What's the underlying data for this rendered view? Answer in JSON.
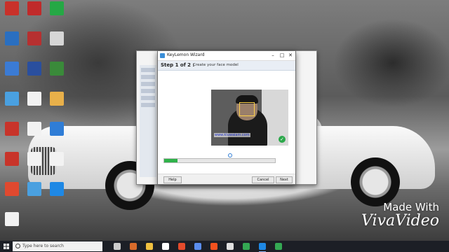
{
  "desktop_icons": [
    {
      "label": "",
      "color": "#c9312a"
    },
    {
      "label": "",
      "color": "#c02a2a"
    },
    {
      "label": "",
      "color": "#25a845"
    },
    {
      "label": "",
      "color": "#2a6fc0"
    },
    {
      "label": "",
      "color": "#b63030"
    },
    {
      "label": "",
      "color": "#d6d6d6"
    },
    {
      "label": "",
      "color": "#3b7bd4"
    },
    {
      "label": "",
      "color": "#2a4f9e"
    },
    {
      "label": "",
      "color": "#3a8a3a"
    },
    {
      "label": "",
      "color": "#4aa0e0"
    },
    {
      "label": "",
      "color": "#f2f2f2"
    },
    {
      "label": "",
      "color": "#e8b04a"
    },
    {
      "label": "",
      "color": "#c8342a"
    },
    {
      "label": "",
      "color": "#f2f2f2"
    },
    {
      "label": "",
      "color": "#2f7dd6"
    },
    {
      "label": "",
      "color": "#c8342a"
    },
    {
      "label": "",
      "color": "#f2f2f2"
    },
    {
      "label": "",
      "color": "#f2f2f2"
    },
    {
      "label": "",
      "color": "#e0492f"
    },
    {
      "label": "",
      "color": "#4aa0e0"
    },
    {
      "label": "",
      "color": "#1e88e5"
    },
    {
      "label": "",
      "color": "#f2f2f2"
    }
  ],
  "wizard": {
    "title": "KeyLemon Wizard",
    "step": "Step 1 of 2 :",
    "instruction": "Create your face model",
    "description": "",
    "left_text": "",
    "camera_caption": "www.kluwaiam.com",
    "camera_status": "",
    "progress": 0.12,
    "progress_label": "",
    "help_button": "Help",
    "cancel_button": "Cancel",
    "next_button": "Next"
  },
  "watermark": {
    "made_with": "Made With",
    "brand": "VivaVideo"
  },
  "taskbar": {
    "search_placeholder": "Type here to search",
    "apps": [
      "#cccccc",
      "#d96b2b",
      "#f0c040",
      "#ffffff",
      "#e54b2c",
      "#5a8dee",
      "#f4511e",
      "#e0e0e0",
      "#34a853",
      "#1e88e5",
      "#34a853"
    ],
    "active_index": 9,
    "tray": ""
  }
}
